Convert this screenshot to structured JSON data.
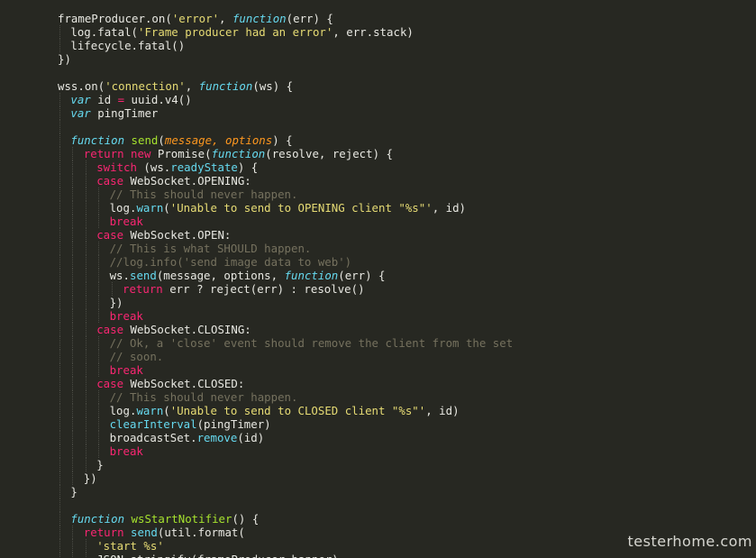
{
  "theme_colors": {
    "background": "#272822",
    "text": "#e8e8e2",
    "string": "#e6db74",
    "keyword": "#f92672",
    "storage": "#66d9ef",
    "function_name": "#a6e22e",
    "property": "#66d9ef",
    "parameter": "#fd971f",
    "comment": "#75715e"
  },
  "watermark": "testerhome.com",
  "code_lines": [
    {
      "indent": 0,
      "tokens": [
        [
          "text",
          "frameProducer.on("
        ],
        [
          "str",
          "'error'"
        ],
        [
          "text",
          ", "
        ],
        [
          "storage",
          "function"
        ],
        [
          "text",
          "(err) {"
        ]
      ]
    },
    {
      "indent": 1,
      "tokens": [
        [
          "text",
          "log.fatal("
        ],
        [
          "str",
          "'Frame producer had an error'"
        ],
        [
          "text",
          ", err.stack)"
        ]
      ]
    },
    {
      "indent": 1,
      "tokens": [
        [
          "text",
          "lifecycle.fatal()"
        ]
      ]
    },
    {
      "indent": 0,
      "tokens": [
        [
          "text",
          "})"
        ]
      ]
    },
    {
      "indent": 0,
      "tokens": []
    },
    {
      "indent": 0,
      "tokens": [
        [
          "text",
          "wss.on("
        ],
        [
          "str",
          "'connection'"
        ],
        [
          "text",
          ", "
        ],
        [
          "storage",
          "function"
        ],
        [
          "text",
          "(ws) {"
        ]
      ]
    },
    {
      "indent": 1,
      "tokens": [
        [
          "storage",
          "var"
        ],
        [
          "text",
          " id "
        ],
        [
          "kw",
          "="
        ],
        [
          "text",
          " uuid.v4()"
        ]
      ]
    },
    {
      "indent": 1,
      "tokens": [
        [
          "storage",
          "var"
        ],
        [
          "text",
          " pingTimer"
        ]
      ]
    },
    {
      "indent": 1,
      "tokens": []
    },
    {
      "indent": 1,
      "tokens": [
        [
          "storage",
          "function"
        ],
        [
          "text",
          " "
        ],
        [
          "func",
          "send"
        ],
        [
          "text",
          "("
        ],
        [
          "param",
          "message, options"
        ],
        [
          "text",
          ") {"
        ]
      ]
    },
    {
      "indent": 2,
      "tokens": [
        [
          "kw",
          "return"
        ],
        [
          "text",
          " "
        ],
        [
          "kw",
          "new"
        ],
        [
          "text",
          " Promise("
        ],
        [
          "storage",
          "function"
        ],
        [
          "text",
          "(resolve, reject) {"
        ]
      ]
    },
    {
      "indent": 3,
      "tokens": [
        [
          "kw",
          "switch"
        ],
        [
          "text",
          " (ws."
        ],
        [
          "prop",
          "readyState"
        ],
        [
          "text",
          ") {"
        ]
      ]
    },
    {
      "indent": 3,
      "tokens": [
        [
          "kw",
          "case"
        ],
        [
          "text",
          " WebSocket.OPENING:"
        ]
      ]
    },
    {
      "indent": 4,
      "tokens": [
        [
          "comment",
          "// This should never happen."
        ]
      ]
    },
    {
      "indent": 4,
      "tokens": [
        [
          "text",
          "log."
        ],
        [
          "prop",
          "warn"
        ],
        [
          "text",
          "("
        ],
        [
          "str",
          "'Unable to send to OPENING client \"%s\"'"
        ],
        [
          "text",
          ", id)"
        ]
      ]
    },
    {
      "indent": 4,
      "tokens": [
        [
          "kw",
          "break"
        ]
      ]
    },
    {
      "indent": 3,
      "tokens": [
        [
          "kw",
          "case"
        ],
        [
          "text",
          " WebSocket.OPEN:"
        ]
      ]
    },
    {
      "indent": 4,
      "tokens": [
        [
          "comment",
          "// This is what SHOULD happen."
        ]
      ]
    },
    {
      "indent": 4,
      "tokens": [
        [
          "comment",
          "//log.info('send image data to web')"
        ]
      ]
    },
    {
      "indent": 4,
      "tokens": [
        [
          "text",
          "ws."
        ],
        [
          "prop",
          "send"
        ],
        [
          "text",
          "(message, options, "
        ],
        [
          "storage",
          "function"
        ],
        [
          "text",
          "(err) {"
        ]
      ]
    },
    {
      "indent": 5,
      "tokens": [
        [
          "kw",
          "return"
        ],
        [
          "text",
          " err ? reject(err) : resolve()"
        ]
      ]
    },
    {
      "indent": 4,
      "tokens": [
        [
          "text",
          "})"
        ]
      ]
    },
    {
      "indent": 4,
      "tokens": [
        [
          "kw",
          "break"
        ]
      ]
    },
    {
      "indent": 3,
      "tokens": [
        [
          "kw",
          "case"
        ],
        [
          "text",
          " WebSocket.CLOSING:"
        ]
      ]
    },
    {
      "indent": 4,
      "tokens": [
        [
          "comment",
          "// Ok, a 'close' event should remove the client from the set"
        ]
      ]
    },
    {
      "indent": 4,
      "tokens": [
        [
          "comment",
          "// soon."
        ]
      ]
    },
    {
      "indent": 4,
      "tokens": [
        [
          "kw",
          "break"
        ]
      ]
    },
    {
      "indent": 3,
      "tokens": [
        [
          "kw",
          "case"
        ],
        [
          "text",
          " WebSocket.CLOSED:"
        ]
      ]
    },
    {
      "indent": 4,
      "tokens": [
        [
          "comment",
          "// This should never happen."
        ]
      ]
    },
    {
      "indent": 4,
      "tokens": [
        [
          "text",
          "log."
        ],
        [
          "prop",
          "warn"
        ],
        [
          "text",
          "("
        ],
        [
          "str",
          "'Unable to send to CLOSED client \"%s\"'"
        ],
        [
          "text",
          ", id)"
        ]
      ]
    },
    {
      "indent": 4,
      "tokens": [
        [
          "prop",
          "clearInterval"
        ],
        [
          "text",
          "(pingTimer)"
        ]
      ]
    },
    {
      "indent": 4,
      "tokens": [
        [
          "text",
          "broadcastSet."
        ],
        [
          "prop",
          "remove"
        ],
        [
          "text",
          "(id)"
        ]
      ]
    },
    {
      "indent": 4,
      "tokens": [
        [
          "kw",
          "break"
        ]
      ]
    },
    {
      "indent": 3,
      "tokens": [
        [
          "text",
          "}"
        ]
      ]
    },
    {
      "indent": 2,
      "tokens": [
        [
          "text",
          "})"
        ]
      ]
    },
    {
      "indent": 1,
      "tokens": [
        [
          "text",
          "}"
        ]
      ]
    },
    {
      "indent": 1,
      "tokens": []
    },
    {
      "indent": 1,
      "tokens": [
        [
          "storage",
          "function"
        ],
        [
          "text",
          " "
        ],
        [
          "func",
          "wsStartNotifier"
        ],
        [
          "text",
          "() {"
        ]
      ]
    },
    {
      "indent": 2,
      "tokens": [
        [
          "kw",
          "return"
        ],
        [
          "text",
          " "
        ],
        [
          "prop",
          "send"
        ],
        [
          "text",
          "(util.format("
        ]
      ]
    },
    {
      "indent": 3,
      "tokens": [
        [
          "str",
          "'start %s'"
        ]
      ]
    },
    {
      "indent": 3,
      "tokens": [
        [
          "text",
          "JSON.stringify(frameProducer.banner)"
        ]
      ]
    }
  ]
}
